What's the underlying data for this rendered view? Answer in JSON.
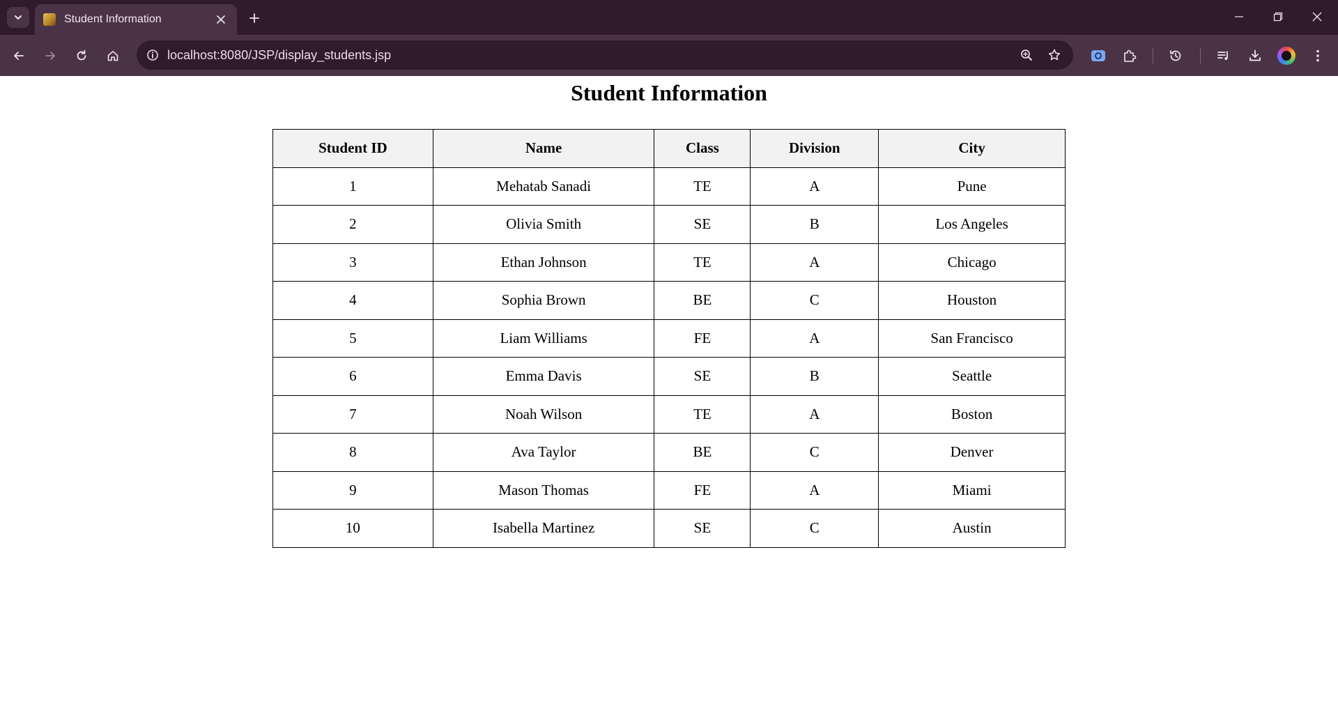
{
  "browser": {
    "tab": {
      "title": "Student Information"
    },
    "address_bar": {
      "url": "localhost:8080/JSP/display_students.jsp"
    }
  },
  "page": {
    "title": "Student Information",
    "table": {
      "headers": [
        "Student ID",
        "Name",
        "Class",
        "Division",
        "City"
      ],
      "rows": [
        [
          "1",
          "Mehatab Sanadi",
          "TE",
          "A",
          "Pune"
        ],
        [
          "2",
          "Olivia Smith",
          "SE",
          "B",
          "Los Angeles"
        ],
        [
          "3",
          "Ethan Johnson",
          "TE",
          "A",
          "Chicago"
        ],
        [
          "4",
          "Sophia Brown",
          "BE",
          "C",
          "Houston"
        ],
        [
          "5",
          "Liam Williams",
          "FE",
          "A",
          "San Francisco"
        ],
        [
          "6",
          "Emma Davis",
          "SE",
          "B",
          "Seattle"
        ],
        [
          "7",
          "Noah Wilson",
          "TE",
          "A",
          "Boston"
        ],
        [
          "8",
          "Ava Taylor",
          "BE",
          "C",
          "Denver"
        ],
        [
          "9",
          "Mason Thomas",
          "FE",
          "A",
          "Miami"
        ],
        [
          "10",
          "Isabella Martinez",
          "SE",
          "C",
          "Austin"
        ]
      ]
    }
  },
  "theme": {
    "tabbar_bg": "#2f1b2d",
    "toolbar_bg": "#4a3346",
    "header_cell_bg": "#f2f2f2"
  }
}
